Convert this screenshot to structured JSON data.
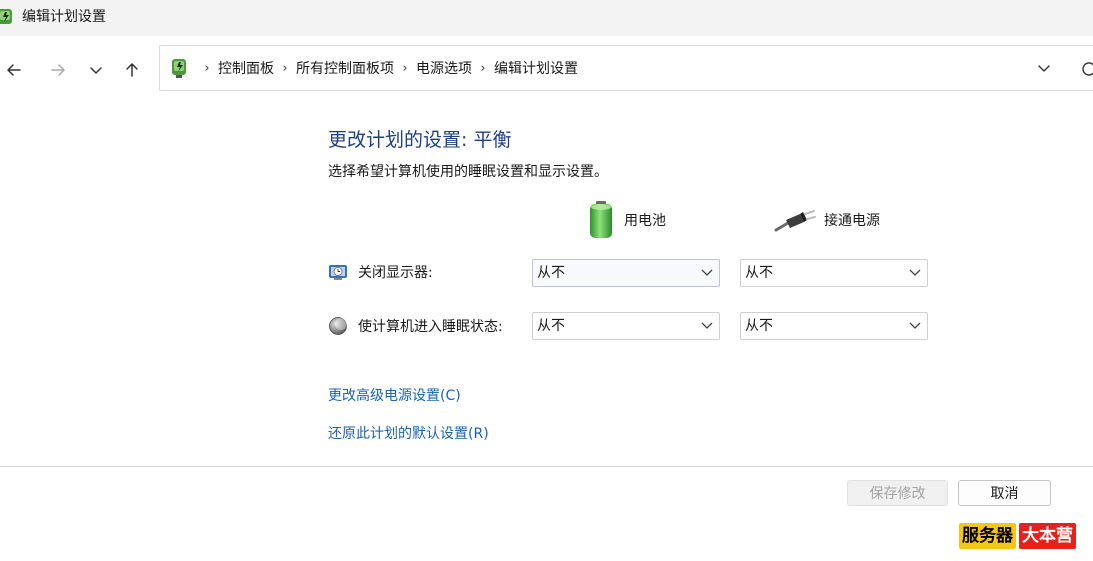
{
  "window": {
    "title": "编辑计划设置"
  },
  "nav": {
    "breadcrumbs": [
      "控制面板",
      "所有控制面板项",
      "电源选项",
      "编辑计划设置"
    ],
    "separator": "›"
  },
  "main": {
    "heading": "更改计划的设置: 平衡",
    "subtitle": "选择希望计算机使用的睡眠设置和显示设置。",
    "columns": {
      "battery": "用电池",
      "plugged": "接通电源"
    },
    "rows": [
      {
        "label": "关闭显示器:",
        "battery_value": "从不",
        "plugged_value": "从不"
      },
      {
        "label": "使计算机进入睡眠状态:",
        "battery_value": "从不",
        "plugged_value": "从不"
      }
    ],
    "links": {
      "advanced": "更改高级电源设置(C)",
      "restore": "还原此计划的默认设置(R)"
    }
  },
  "footer": {
    "save_label": "保存修改",
    "cancel_label": "取消"
  },
  "watermark": {
    "part1": "服务器",
    "part2": "大本营"
  },
  "colors": {
    "heading": "#1e3f87",
    "link": "#1763b6",
    "battery_green": "#3cb44a",
    "watermark_yellow": "#f5c518",
    "watermark_red": "#e8201c"
  }
}
